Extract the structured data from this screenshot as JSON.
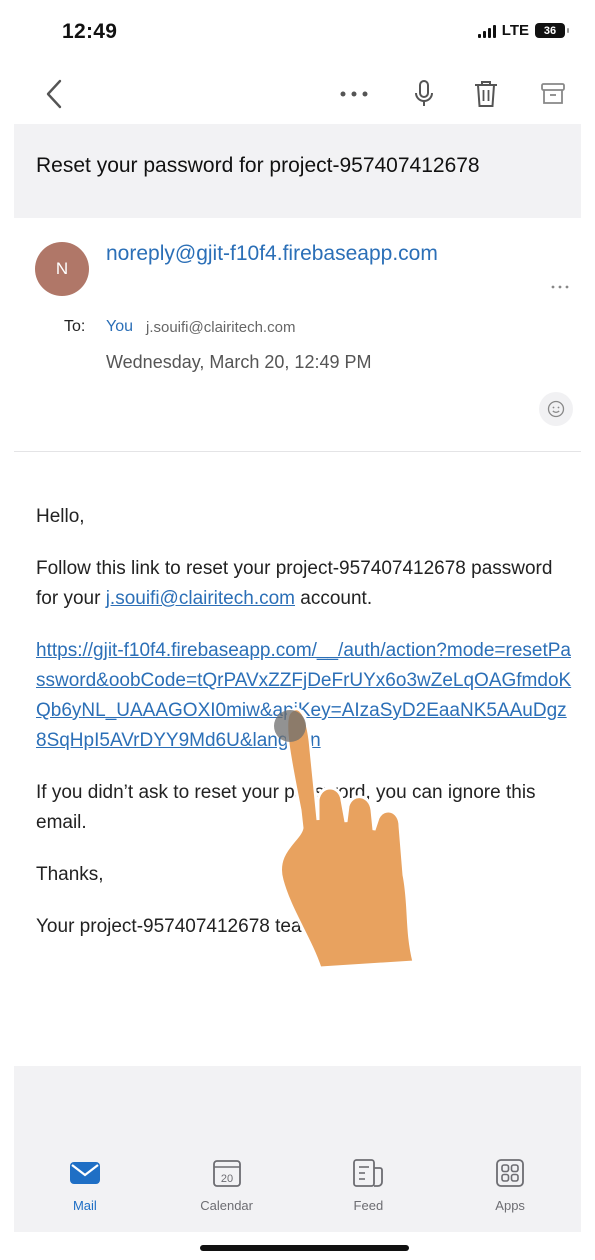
{
  "status_bar": {
    "time": "12:49",
    "network": "LTE",
    "battery": "36"
  },
  "toolbar": {
    "back_icon": "chevron-left-icon",
    "more_icon": "ellipsis-icon",
    "mic_icon": "microphone-icon",
    "trash_icon": "trash-icon",
    "archive_icon": "archive-icon"
  },
  "email": {
    "subject": "Reset your password for project-957407412678",
    "sender": {
      "initial": "N",
      "email": "noreply@gjit-f10f4.firebaseapp.com",
      "avatar_color": "#b07768"
    },
    "to_label": "To:",
    "to_you": "You",
    "to_address": "j.souifi@clairitech.com",
    "date": "Wednesday, March 20, 12:49 PM",
    "body": {
      "greeting": "Hello,",
      "line1_before": "Follow this link to reset your project-957407412678 password for your ",
      "line1_link": "j.souifi@clairitech.com",
      "line1_after": " account.",
      "reset_link": "https://gjit-f10f4.firebaseapp.com/__/auth/action?mode=resetPassword&oobCode=tQrPAVxZZFjDeFrUYx6o3wZeLqOAGfmdoKQb6yNL_UAAAGOXI0miw&apiKey=AIzaSyD2EaaNK5AAuDgz8SqHpI5AVrDYY9Md6U&lang=en",
      "ignore": "If you didn’t ask to reset your password, you can ignore this email.",
      "thanks": "Thanks,",
      "signature": "Your project-957407412678 team"
    }
  },
  "tab_bar": {
    "tabs": [
      {
        "label": "Mail",
        "icon": "mail-icon",
        "active": true
      },
      {
        "label": "Calendar",
        "icon": "calendar-icon",
        "day": "20",
        "active": false
      },
      {
        "label": "Feed",
        "icon": "feed-icon",
        "active": false
      },
      {
        "label": "Apps",
        "icon": "apps-icon",
        "active": false
      }
    ]
  },
  "colors": {
    "accent": "#1f6fc5",
    "link": "#2b6fb7",
    "panel": "#f2f2f4",
    "touch_hand": "#e8a25f"
  }
}
